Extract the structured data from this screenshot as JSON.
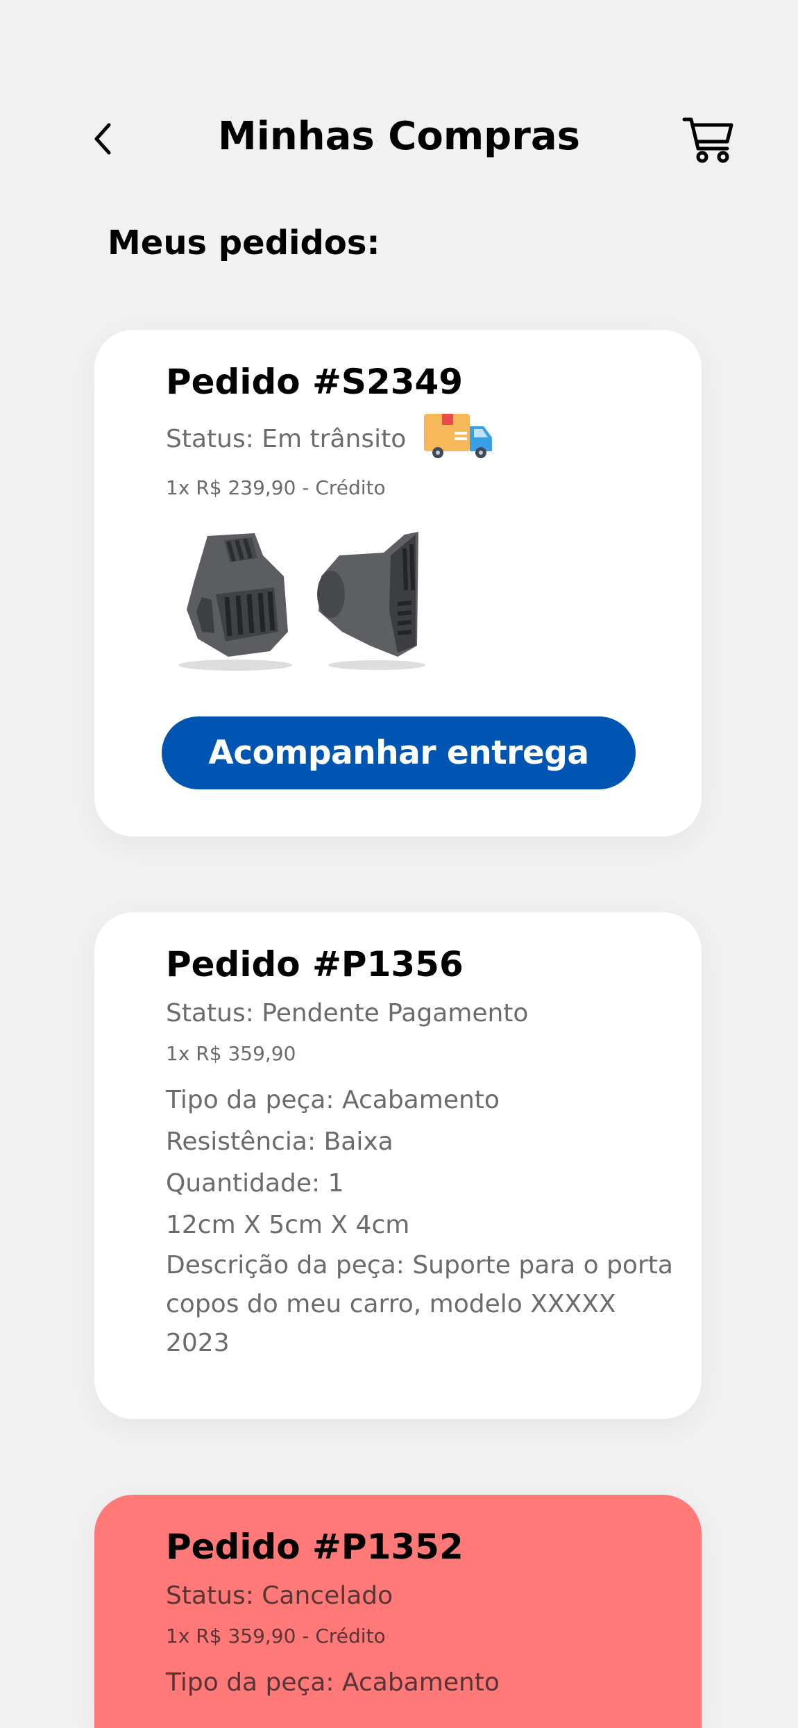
{
  "header": {
    "title": "Minhas Compras",
    "back_icon": "chevron-left-icon",
    "cart_icon": "cart-icon"
  },
  "section": {
    "title": "Meus pedidos:"
  },
  "orders": [
    {
      "title": "Pedido #S2349",
      "status": "Status: Em trânsito",
      "status_icon": "delivery-truck-icon",
      "price": "1x R$ 239,90 - Crédito",
      "button_label": "Acompanhar entrega"
    },
    {
      "title": "Pedido #P1356",
      "status": "Status: Pendente Pagamento",
      "price": "1x R$ 359,90",
      "details": [
        "Tipo da peça: Acabamento",
        "Resistência: Baixa",
        "Quantidade: 1",
        "12cm X 5cm X 4cm",
        "Descrição da peça: Suporte para o porta copos do meu carro, modelo XXXXX 2023"
      ]
    },
    {
      "title": "Pedido #P1352",
      "status": "Status: Cancelado",
      "price": "1x R$ 359,90 - Crédito",
      "details": [
        "Tipo da peça: Acabamento"
      ]
    }
  ],
  "colors": {
    "background": "#f1f1f2",
    "card": "#ffffff",
    "cancelled_card": "#ff7979",
    "primary_button": "#0055b3"
  }
}
